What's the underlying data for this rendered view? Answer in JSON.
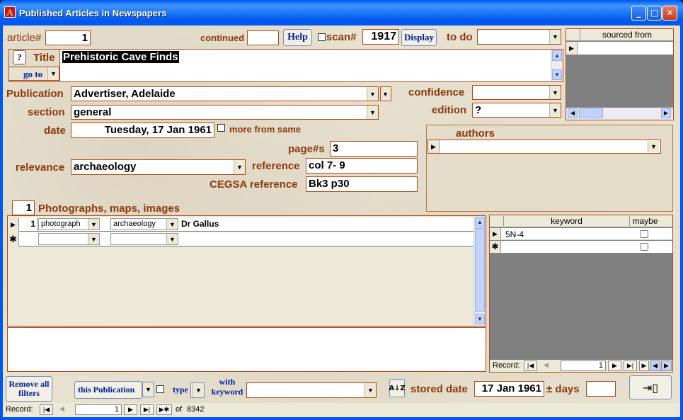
{
  "window": {
    "title": "Published Articles in Newspapers",
    "minimize": "_",
    "maximize": "□",
    "close": "✕"
  },
  "article": {
    "label": "article#",
    "value": "1"
  },
  "continued": {
    "label": "continued",
    "value": ""
  },
  "help_label": "Help",
  "scan": {
    "label": "scan#",
    "value": "1917",
    "display_label": "Display"
  },
  "todo": {
    "label": "to do",
    "value": ""
  },
  "sourced_from": {
    "header": "sourced from"
  },
  "title": {
    "label": "Title",
    "value": "Prehistoric Cave Finds",
    "goto_label": "go to"
  },
  "publication": {
    "label": "Publication",
    "value": "Advertiser,  Adelaide"
  },
  "confidence": {
    "label": "confidence",
    "value": ""
  },
  "section": {
    "label": "section",
    "value": "general"
  },
  "edition": {
    "label": "edition",
    "value": "?"
  },
  "date": {
    "label": "date",
    "value": "Tuesday, 17 Jan 1961",
    "more_label": "more from same"
  },
  "authors": {
    "label": "authors"
  },
  "pages": {
    "label": "page#s",
    "value": "3"
  },
  "relevance": {
    "label": "relevance",
    "value": "archaeology"
  },
  "reference": {
    "label": "reference",
    "value": "col 7- 9"
  },
  "cegsa": {
    "label": "CEGSA reference",
    "value": "Bk3 p30"
  },
  "photos": {
    "count": "1",
    "label": "Photographs, maps, images",
    "rows": [
      {
        "num": "1",
        "type": "photograph",
        "category": "archaeology",
        "caption": "Dr Gallus"
      }
    ]
  },
  "keywords": {
    "col_keyword": "keyword",
    "col_maybe": "maybe",
    "rows": [
      {
        "keyword": "5N-4"
      }
    ],
    "record_label": "Record:",
    "record_value": "1"
  },
  "bottom": {
    "remove_filters": "Remove all filters",
    "this_publication": "this Publication",
    "type_label": "type",
    "with_keyword": "with keyword",
    "stored_date_label": "stored date",
    "stored_date_value": "17 Jan 1961",
    "days_label": "± days",
    "days_value": ""
  },
  "nav": {
    "record_label": "Record:",
    "record_value": "1",
    "of_label": "of",
    "total": "8342"
  }
}
